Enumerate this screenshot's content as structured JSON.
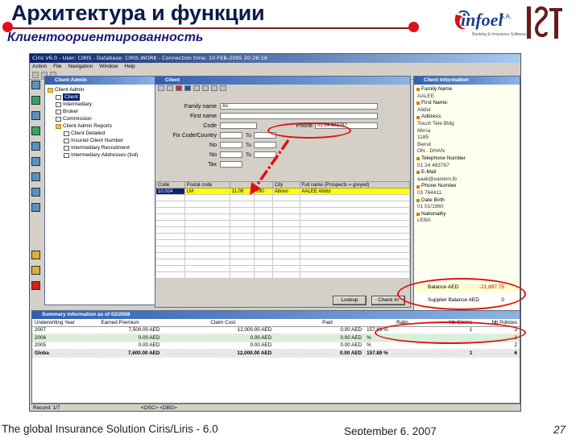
{
  "slide": {
    "title": "Архитектура и функции",
    "subtitle": "Клиентоориентированность",
    "logo_text": "infoel",
    "logo_suffix": "S.A.",
    "logo_tagline": "Banking & Insurance Software",
    "footer_left": "The global Insurance Solution  Ciris/Liris - 6.0",
    "footer_date": "September 6, 2007",
    "page_number": "27",
    "colors": {
      "title": "#0b1a4a",
      "accent": "#e10f1a",
      "window_title": "#0a246a"
    }
  },
  "app": {
    "title": "Ciris V6.0 - User: CIRIS - Database: CIRIS.WORK - Connection time: 10-FEB-2005 20:26:16",
    "menu": [
      "Action",
      "File",
      "Navigation",
      "Window",
      "Help"
    ],
    "client_admin": {
      "title": "Client Admin",
      "tree": [
        {
          "label": "Client Admin",
          "level": 0,
          "icon": "folder-icon"
        },
        {
          "label": "Client",
          "level": 1,
          "icon": "document-icon",
          "selected": true
        },
        {
          "label": "Intermediary",
          "level": 1,
          "icon": "document-icon"
        },
        {
          "label": "Broker",
          "level": 1,
          "icon": "document-icon"
        },
        {
          "label": "Commission",
          "level": 1,
          "icon": "document-icon"
        },
        {
          "label": "Client Admin Reports",
          "level": 1,
          "icon": "folder-icon"
        },
        {
          "label": "Client Detailed",
          "level": 2,
          "icon": "document-icon"
        },
        {
          "label": "Insured Client Number",
          "level": 2,
          "icon": "document-icon"
        },
        {
          "label": "Intermediary Recruitment",
          "level": 2,
          "icon": "document-icon"
        },
        {
          "label": "Intermediary Addresses (Ind)",
          "level": 2,
          "icon": "document-icon"
        }
      ]
    },
    "client_form": {
      "title": "Client",
      "fields": [
        {
          "label": "Family name",
          "value": "As"
        },
        {
          "label": "First name",
          "value": ""
        },
        {
          "label": "Code",
          "value": ""
        },
        {
          "label": "Fix Code/Country",
          "value": ""
        },
        {
          "label": "No",
          "value": ""
        },
        {
          "label": "No",
          "value": ""
        },
        {
          "label": "Tax",
          "value": ""
        }
      ],
      "to_labels": [
        "To",
        "To",
        "To"
      ],
      "phone_label": "Phone",
      "phone_value": "01 24 483787"
    },
    "grid": {
      "columns": [
        "Code",
        "Postal code",
        "",
        "",
        "City",
        "Full name (Prospects = greyed)"
      ],
      "highlight_row": [
        "10.024",
        "LM",
        "11.09",
        "790",
        "Abovo",
        "AALEE Abdul"
      ],
      "empty_rows": 14
    },
    "buttons": {
      "lookup": "Lookup",
      "check": "Check In"
    },
    "client_info": {
      "title": "Client Information",
      "items": [
        {
          "label": "Family Name",
          "value": "AALEE"
        },
        {
          "label": "First Name:",
          "value": "Abdul"
        },
        {
          "label": "Address:",
          "value": "Touch Tele Bldg"
        },
        {
          "label": "",
          "value": "Mirna"
        },
        {
          "label": "",
          "value": "1185"
        },
        {
          "label": "",
          "value": "Beirut"
        },
        {
          "label": "",
          "value": "ON - DHAN"
        },
        {
          "label": "Telephone Number",
          "value": "01 24 483787"
        },
        {
          "label": "E-Mail",
          "value": "aaali@eastern.lb"
        },
        {
          "label": "Phone Number",
          "value": "03 764411"
        },
        {
          "label": "Date Birth",
          "value": "01 01/1960"
        },
        {
          "label": "Nationality",
          "value": "LEBA"
        }
      ],
      "balance_label": "Balance AED",
      "balance_value": "-21,897.75",
      "supplier_label": "Supplier Balance AED",
      "supplier_value": "0"
    },
    "summary": {
      "title": "Summary information as of 02/2008",
      "columns": [
        "Underwriting Year",
        "Earned Premium",
        "Claim Cost",
        "Paid",
        "Ratio",
        "Nb Claims",
        "Nb Policies"
      ],
      "rows": [
        [
          "2007",
          "7,500.00 AED",
          "12,000.00 AED",
          "0.00 AED",
          "157.89 %",
          "1",
          "3"
        ],
        [
          "2006",
          "0.00 AED",
          "0.00 AED",
          "0.00 AED",
          "%",
          "",
          "1"
        ],
        [
          "2005",
          "0.00 AED",
          "0.00 AED",
          "0.00 AED",
          "%",
          "",
          "2"
        ]
      ],
      "total": [
        "Globa",
        "7,600.00 AED",
        "12,000.00 AED",
        "0.00 AED",
        "157.89 %",
        "1",
        "6"
      ]
    },
    "status": {
      "left": "Record: 1/7",
      "mid": "<OSC> <DBG>"
    }
  }
}
